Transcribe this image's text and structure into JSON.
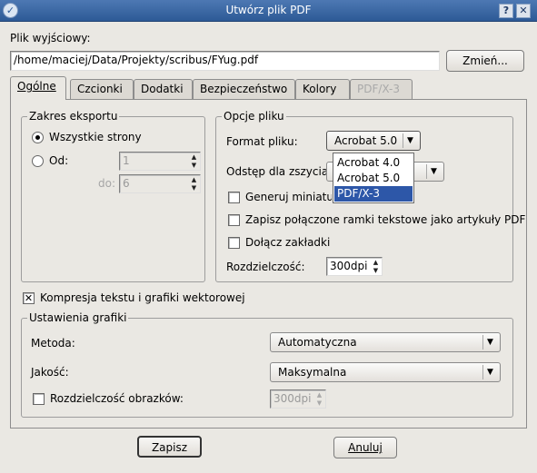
{
  "window": {
    "title": "Utwórz plik PDF",
    "help": "?",
    "close": "✕",
    "app_icon": "✓"
  },
  "output": {
    "label": "Plik wyjściowy:",
    "path": "/home/maciej/Data/Projekty/scribus/FYug.pdf",
    "change_button": "Zmień..."
  },
  "tabs": [
    {
      "label": "Ogólne",
      "active": true
    },
    {
      "label": "Czcionki"
    },
    {
      "label": "Dodatki"
    },
    {
      "label": "Bezpieczeństwo"
    },
    {
      "label": "Kolory"
    },
    {
      "label": "PDF/X-3",
      "disabled": true
    }
  ],
  "export_range": {
    "legend": "Zakres eksportu",
    "all_pages": "Wszystkie strony",
    "from_label": "Od:",
    "from_value": "1",
    "to_label": "do:",
    "to_value": "6"
  },
  "file_options": {
    "legend": "Opcje pliku",
    "format_label": "Format pliku:",
    "format_value": "Acrobat 5.0",
    "format_options": [
      "Acrobat 4.0",
      "Acrobat 5.0",
      "PDF/X-3"
    ],
    "binding_label": "Odstęp dla zszycia:",
    "generate_thumbs": "Generuj miniatury",
    "save_linked_frames": "Zapisz połączone ramki tekstowe jako artykuły PDF",
    "include_bookmarks": "Dołącz zakładki",
    "resolution_label": "Rozdzielczość:",
    "resolution_value": "300dpi"
  },
  "compression": {
    "label": "Kompresja tekstu i grafiki wektorowej",
    "checked": true
  },
  "image_settings": {
    "legend": "Ustawienia grafiki",
    "method_label": "Metoda:",
    "method_value": "Automatyczna",
    "quality_label": "Jakość:",
    "quality_value": "Maksymalna",
    "img_res_label": "Rozdzielczość obrazków:",
    "img_res_value": "300dpi"
  },
  "buttons": {
    "save": "Zapisz",
    "cancel": "Anuluj"
  }
}
